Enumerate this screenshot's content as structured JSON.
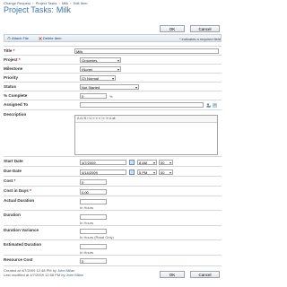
{
  "breadcrumb": [
    "Change Request",
    "Project Tasks",
    "Milk",
    "Edit Item"
  ],
  "breadcrumb_sep": "›",
  "page_title": {
    "prefix": "Project Tasks:",
    "item": "Milk"
  },
  "buttons": {
    "ok": "OK",
    "cancel": "Cancel"
  },
  "toolbar": {
    "attach": "Attach File",
    "delete": "Delete Item"
  },
  "required_note": {
    "star": "*",
    "text": " indicates a required field"
  },
  "fields": {
    "title": {
      "label": "Title",
      "value": "Milk"
    },
    "project": {
      "label": "Project",
      "value": "Groceries"
    },
    "milestone": {
      "label": "Milestone",
      "value": "(None)"
    },
    "priority": {
      "label": "Priority",
      "value": "(2) Normal"
    },
    "status": {
      "label": "Status",
      "value": "Not Started"
    },
    "percent": {
      "label": "% Complete",
      "value": "0",
      "unit": "%"
    },
    "assigned": {
      "label": "Assigned To",
      "value": ""
    },
    "description": {
      "label": "Description",
      "toolbar": "A  AI  B I U  ≡ ≡ ≡  ⁝≡ ⁝≡  A  ⇄"
    },
    "start_date": {
      "label": "Start Date",
      "date": "4/7/2009",
      "hour": "8 AM",
      "minute": "00"
    },
    "due_date": {
      "label": "Due Date",
      "date": "4/14/2009",
      "hour": "5 PM",
      "minute": "00"
    },
    "cost": {
      "label": "Cost",
      "value": "0"
    },
    "cost_days": {
      "label": "Cost in Days",
      "value": "0.00"
    },
    "actual_duration": {
      "label": "Actual Duration",
      "value": "",
      "hint": "In Hours"
    },
    "duration": {
      "label": "Duration",
      "value": "",
      "hint": "In Hours"
    },
    "duration_variance": {
      "label": "Duration Variance",
      "value": "",
      "hint": "In Hours (Read Only)"
    },
    "estimated_duration": {
      "label": "Estimated Duration",
      "value": "",
      "hint": "In Hours"
    },
    "resource_cost": {
      "label": "Resource Cost",
      "value": "0"
    }
  },
  "footer": {
    "created": "Created at 4/7/2009 12:48 PM  by",
    "created_by": "John Milan",
    "modified": "Last modified at 4/7/2009 12:58 PM  by",
    "modified_by": "John Milan"
  },
  "required_star": "*"
}
